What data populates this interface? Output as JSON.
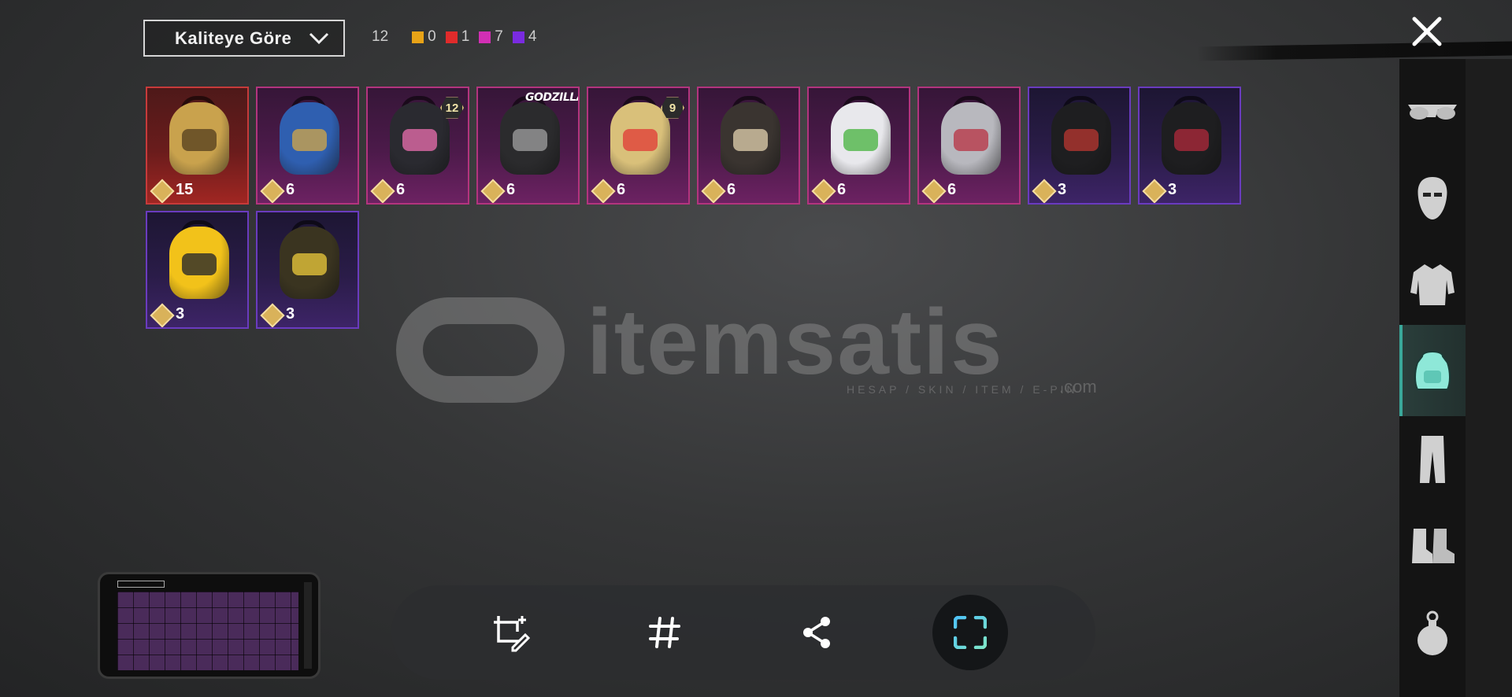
{
  "sort": {
    "label": "Kaliteye Göre",
    "icon": "chevron-down-icon"
  },
  "counts": {
    "total": "12",
    "items": [
      {
        "color": "#e8a317",
        "value": "0"
      },
      {
        "color": "#e02b2b",
        "value": "1"
      },
      {
        "color": "#d22fb4",
        "value": "7"
      },
      {
        "color": "#7a2be0",
        "value": "4"
      }
    ]
  },
  "items": [
    {
      "qty": "15",
      "rarity": "red",
      "color": "#c9a24d",
      "accent": "#5a4420"
    },
    {
      "qty": "6",
      "rarity": "pink",
      "color": "#2f5fb0",
      "accent": "#c9a24d"
    },
    {
      "qty": "6",
      "rarity": "pink",
      "color": "#2a2a30",
      "accent": "#e06aa8",
      "badge": "12"
    },
    {
      "qty": "6",
      "rarity": "pink",
      "color": "#2b2b2d",
      "accent": "#9a9a9a",
      "brand": "GODZILLA"
    },
    {
      "qty": "6",
      "rarity": "pink",
      "color": "#d9c07a",
      "accent": "#e0413a",
      "badge": "9"
    },
    {
      "qty": "6",
      "rarity": "pink",
      "color": "#3a3430",
      "accent": "#d8c8a8"
    },
    {
      "qty": "6",
      "rarity": "pink",
      "color": "#e8e8ec",
      "accent": "#4fb548"
    },
    {
      "qty": "6",
      "rarity": "pink",
      "color": "#b8b8be",
      "accent": "#b83a4a"
    },
    {
      "qty": "3",
      "rarity": "purple",
      "color": "#1e1e20",
      "accent": "#b0352f"
    },
    {
      "qty": "3",
      "rarity": "purple",
      "color": "#1e1e20",
      "accent": "#a8283a"
    },
    {
      "qty": "3",
      "rarity": "purple",
      "color": "#f2c21a",
      "accent": "#2a2a2a"
    },
    {
      "qty": "3",
      "rarity": "purple",
      "color": "#3a3420",
      "accent": "#e2c23a"
    }
  ],
  "watermark": {
    "word": "itemsatis",
    "tagline": "HESAP / SKIN / ITEM / E-PIN",
    "domain": ".com"
  },
  "sidebar": [
    {
      "name": "glasses",
      "active": false
    },
    {
      "name": "mask",
      "active": false
    },
    {
      "name": "jacket",
      "active": false
    },
    {
      "name": "backpack",
      "active": true
    },
    {
      "name": "pants",
      "active": false
    },
    {
      "name": "boots",
      "active": false
    },
    {
      "name": "grenade",
      "active": false
    }
  ],
  "toolbar": [
    "crop-edit-icon",
    "hashtag-icon",
    "share-icon",
    "capture-icon"
  ]
}
